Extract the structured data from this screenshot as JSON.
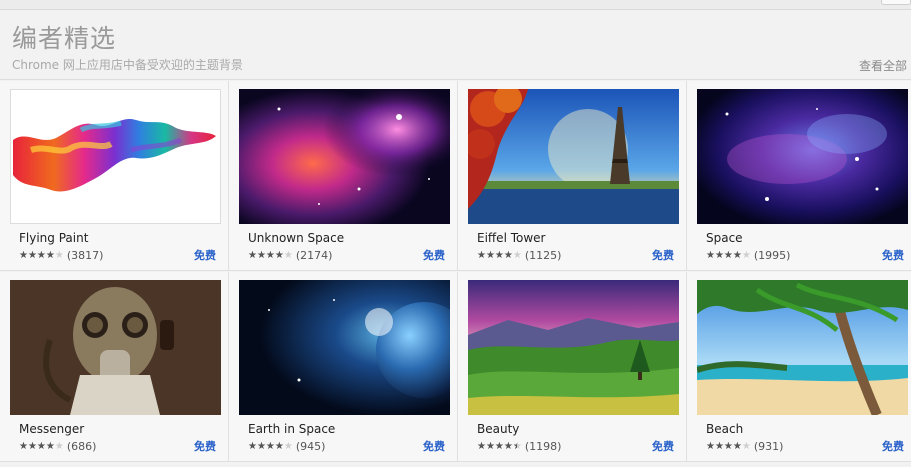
{
  "section": {
    "title": "编者精选",
    "subtitle": "Chrome 网上应用店中备受欢迎的主题背景",
    "view_all": "查看全部"
  },
  "themes": [
    {
      "name": "Flying Paint",
      "count": "(3817)",
      "price": "免费",
      "rating": 4,
      "icon": "flying-paint-thumbnail"
    },
    {
      "name": "Unknown Space",
      "count": "(2174)",
      "price": "免费",
      "rating": 4,
      "icon": "unknown-space-thumbnail"
    },
    {
      "name": "Eiffel Tower",
      "count": "(1125)",
      "price": "免费",
      "rating": 4,
      "icon": "eiffel-tower-thumbnail"
    },
    {
      "name": "Space",
      "count": "(1995)",
      "price": "免费",
      "rating": 4,
      "icon": "space-thumbnail"
    },
    {
      "name": "Messenger",
      "count": "(686)",
      "price": "免费",
      "rating": 4,
      "icon": "messenger-thumbnail"
    },
    {
      "name": "Earth in Space",
      "count": "(945)",
      "price": "免费",
      "rating": 4,
      "icon": "earth-in-space-thumbnail"
    },
    {
      "name": "Beauty",
      "count": "(1198)",
      "price": "免费",
      "rating": 4.5,
      "icon": "beauty-thumbnail"
    },
    {
      "name": "Beach",
      "count": "(931)",
      "price": "免费",
      "rating": 4,
      "icon": "beach-thumbnail"
    }
  ],
  "star_glyphs": "★★★★★",
  "colors": {
    "price": "#2a62c9",
    "title": "#9a9a9a"
  }
}
